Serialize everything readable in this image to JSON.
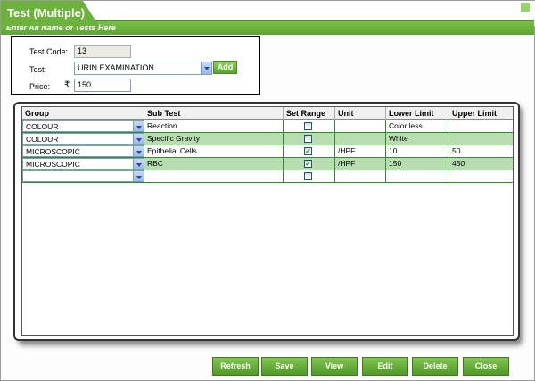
{
  "window": {
    "title": "Test (Multiple)",
    "subtitle": "Enter All Name of Tests Here"
  },
  "form": {
    "test_code_label": "Test Code:",
    "test_code_value": "13",
    "test_label": "Test:",
    "test_value": "URIN EXAMINATION",
    "add_label": "Add",
    "price_label": "Price:",
    "currency_symbol": "₹",
    "price_value": "150"
  },
  "grid": {
    "columns": [
      "Group",
      "Sub Test",
      "Set Range",
      "Unit",
      "Lower Limit",
      "Upper Limit"
    ],
    "rows": [
      {
        "group": "COLOUR",
        "sub_test": "Reaction",
        "set_range": false,
        "unit": "",
        "lower": "Color less",
        "upper": ""
      },
      {
        "group": "COLOUR",
        "sub_test": "Specific Gravity",
        "set_range": false,
        "unit": "",
        "lower": "White",
        "upper": ""
      },
      {
        "group": "MICROSCOPIC",
        "sub_test": "Epithelial Cells",
        "set_range": true,
        "unit": "/HPF",
        "lower": "10",
        "upper": "50"
      },
      {
        "group": "MICROSCOPIC",
        "sub_test": "RBC",
        "set_range": true,
        "unit": "/HPF",
        "lower": "150",
        "upper": "450"
      },
      {
        "group": "",
        "sub_test": "",
        "set_range": false,
        "unit": "",
        "lower": "",
        "upper": ""
      }
    ]
  },
  "buttons": {
    "refresh": "Refresh",
    "save": "Save",
    "view": "View",
    "edit": "Edit",
    "delete": "Delete",
    "close": "Close"
  },
  "colors": {
    "accent": "#6cb23d",
    "row_alt": "#b8ddb0",
    "grid_line": "#2e8b2e"
  },
  "icons": {
    "dropdown": "chevron-down-icon",
    "check": "checkmark-icon",
    "window_close": "close-icon"
  }
}
